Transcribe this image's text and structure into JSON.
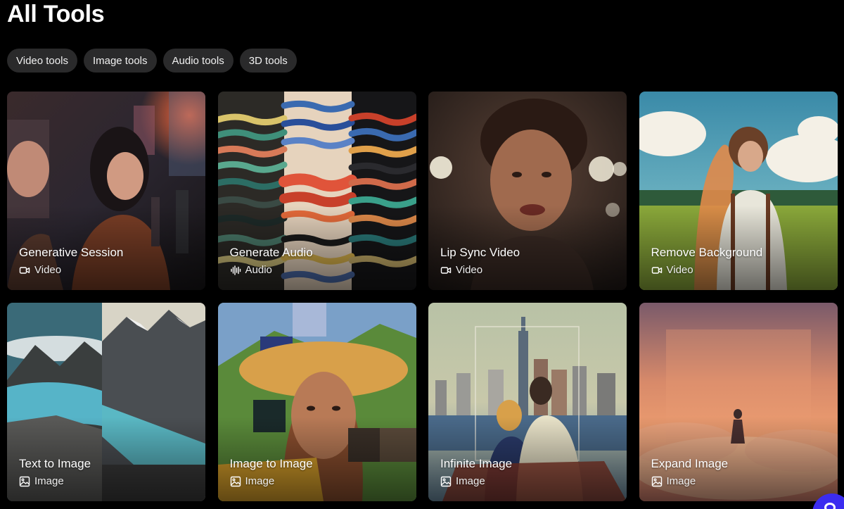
{
  "page": {
    "title": "All Tools"
  },
  "filters": [
    {
      "label": "Video tools"
    },
    {
      "label": "Image tools"
    },
    {
      "label": "Audio tools"
    },
    {
      "label": "3D tools"
    }
  ],
  "tools": [
    {
      "title": "Generative Session",
      "type": "Video",
      "icon": "video-camera-icon",
      "art": "city-night-portrait"
    },
    {
      "title": "Generate Audio",
      "type": "Audio",
      "icon": "audio-waveform-icon",
      "art": "painted-waves"
    },
    {
      "title": "Lip Sync Video",
      "type": "Video",
      "icon": "video-camera-icon",
      "art": "smiling-woman-portrait"
    },
    {
      "title": "Remove Background",
      "type": "Video",
      "icon": "video-camera-icon",
      "art": "man-in-field"
    },
    {
      "title": "Text to Image",
      "type": "Image",
      "icon": "image-icon",
      "art": "mountain-lake"
    },
    {
      "title": "Image to Image",
      "type": "Image",
      "icon": "image-icon",
      "art": "woman-with-sun-hat"
    },
    {
      "title": "Infinite Image",
      "type": "Image",
      "icon": "image-icon",
      "art": "couple-city-skyline"
    },
    {
      "title": "Expand Image",
      "type": "Image",
      "icon": "image-icon",
      "art": "figure-in-clouds"
    }
  ],
  "colors": {
    "background": "#000000",
    "chip": "#2a2a2b",
    "widget": "#3b2cf0"
  }
}
